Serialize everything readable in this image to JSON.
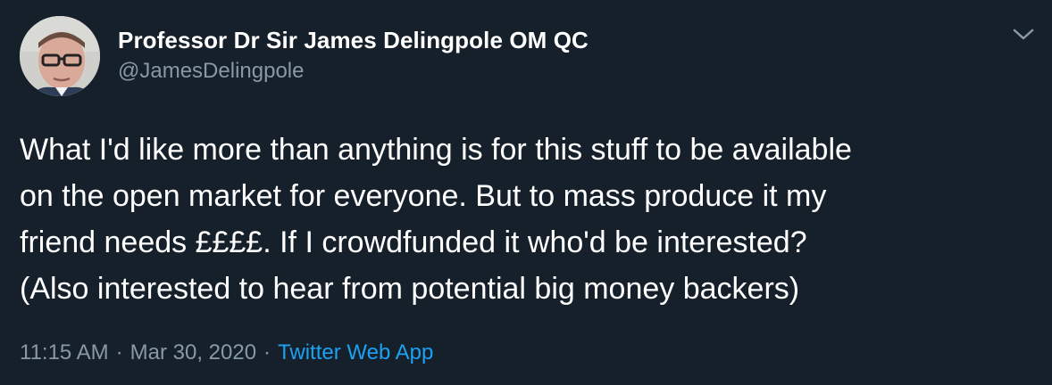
{
  "author": {
    "name": "Professor Dr Sir James Delingpole OM QC",
    "handle": "@JamesDelingpole"
  },
  "tweet": {
    "lines": [
      "What I'd like more than anything is for this stuff to be available",
      "on the open market for everyone. But to mass produce it my",
      "friend needs ££££. If I crowdfunded it who'd be interested?",
      "(Also interested to hear from potential big money backers)"
    ]
  },
  "meta": {
    "time": "11:15 AM",
    "separator": "·",
    "date": "Mar 30, 2020",
    "source": "Twitter Web App"
  },
  "icons": {
    "caret": "chevron-down-icon"
  },
  "colors": {
    "background": "#15202b",
    "text": "#ffffff",
    "secondary": "#8899a6",
    "link": "#1da1f2"
  }
}
